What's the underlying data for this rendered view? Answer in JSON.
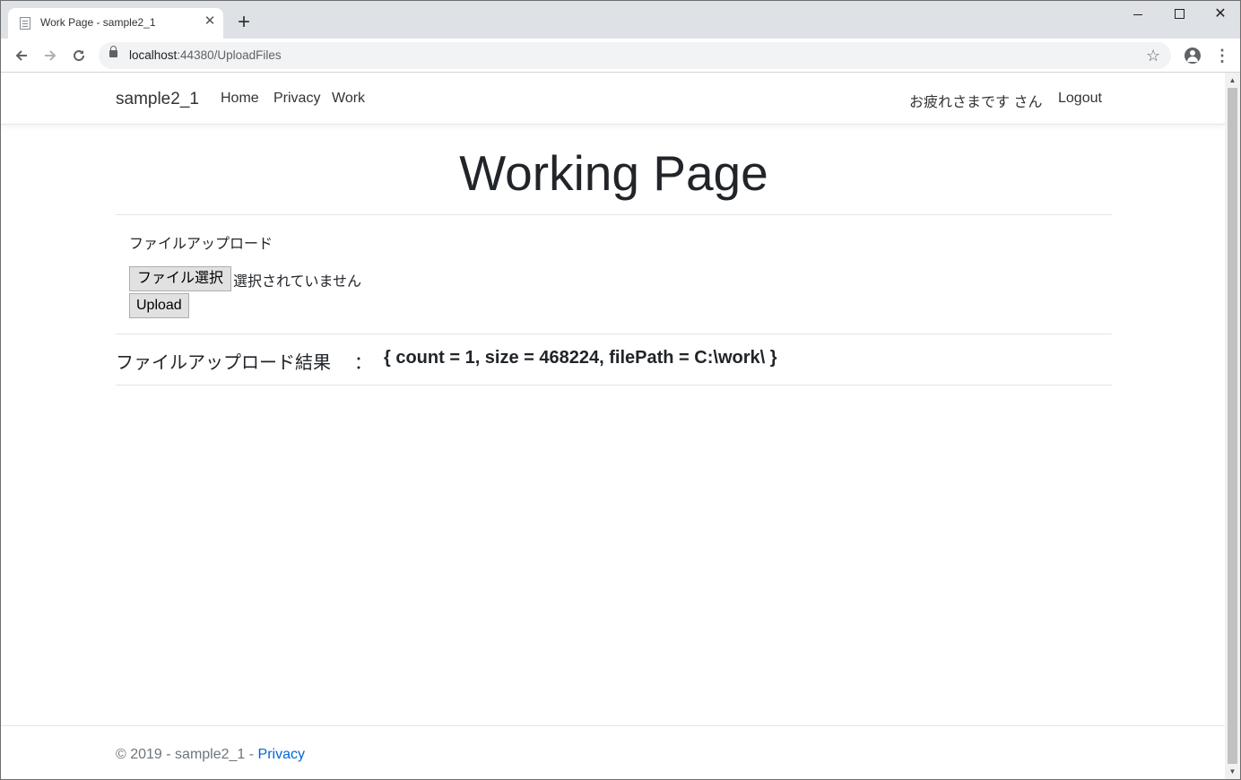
{
  "browser": {
    "tab_title": "Work Page - sample2_1",
    "tab_close_glyph": "✕",
    "new_tab_glyph": "+",
    "url_host": "localhost",
    "url_rest": ":44380/UploadFiles",
    "close_glyph": "✕"
  },
  "navbar": {
    "brand": "sample2_1",
    "links": [
      "Home",
      "Privacy",
      "Work"
    ],
    "greeting": "お疲れさまです さん",
    "logout": "Logout"
  },
  "main": {
    "title": "Working Page",
    "upload_heading": "ファイルアップロード",
    "file_button": "ファイル選択",
    "file_status": "選択されていません",
    "upload_button": "Upload",
    "result_label": "ファイルアップロード結果",
    "result_colon": "：",
    "result_value": "{ count = 1, size = 468224, filePath = C:\\work\\ }"
  },
  "footer": {
    "text": "© 2019 - sample2_1 - ",
    "link": "Privacy"
  },
  "colors": {
    "link": "#0366d6",
    "tabstrip": "#dee1e6",
    "omnibox": "#f1f3f4"
  }
}
